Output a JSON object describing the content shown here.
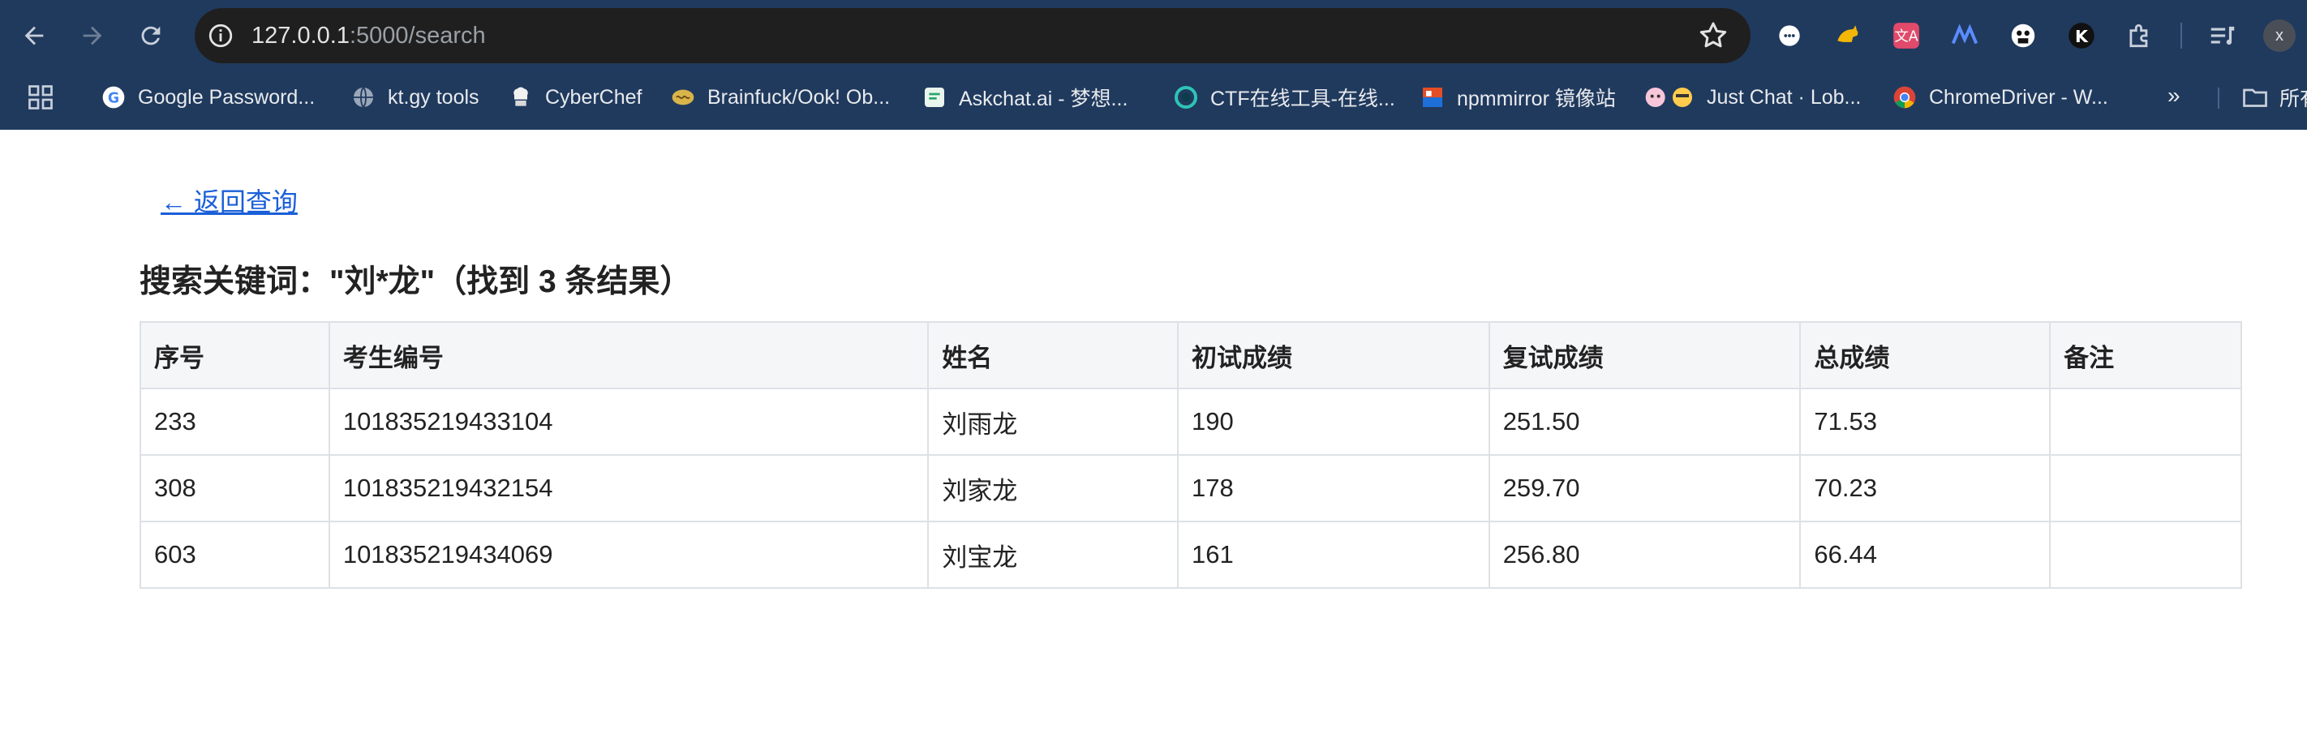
{
  "browser": {
    "url_host": "127.0.0.1",
    "url_rest": ":5000/search",
    "avatar_initial": "x",
    "bookmarks": [
      {
        "label": "Google Password...",
        "icon": "google-icon"
      },
      {
        "label": "kt.gy tools",
        "icon": "globe-icon"
      },
      {
        "label": "CyberChef",
        "icon": "chef-icon"
      },
      {
        "label": "Brainfuck/Ook! Ob...",
        "icon": "brain-icon"
      },
      {
        "label": "Askchat.ai - 梦想...",
        "icon": "chat-icon"
      },
      {
        "label": "CTF在线工具-在线...",
        "icon": "ctf-icon"
      },
      {
        "label": "npmmirror 镜像站",
        "icon": "npm-icon"
      },
      {
        "label": "Just Chat · Lob...",
        "icon": "emoji-icon"
      },
      {
        "label": "ChromeDriver - W...",
        "icon": "chrome-icon"
      }
    ],
    "more_label": "»",
    "folder_label": "所有"
  },
  "page": {
    "back_link": "← 返回查询",
    "heading": "搜索关键词：\"刘*龙\"（找到 3 条结果）",
    "table": {
      "headers": [
        "序号",
        "考生编号",
        "姓名",
        "初试成绩",
        "复试成绩",
        "总成绩",
        "备注"
      ],
      "rows": [
        [
          "233",
          "101835219433104",
          "刘雨龙",
          "190",
          "251.50",
          "71.53",
          ""
        ],
        [
          "308",
          "101835219432154",
          "刘家龙",
          "178",
          "259.70",
          "70.23",
          ""
        ],
        [
          "603",
          "101835219434069",
          "刘宝龙",
          "161",
          "256.80",
          "66.44",
          ""
        ]
      ]
    }
  },
  "colors": {
    "chrome_bg": "#203a5e",
    "omnibox_bg": "#1f1f1f",
    "link": "#1a5fd8",
    "table_border": "#dde1e5",
    "header_bg": "#f5f6f8"
  }
}
